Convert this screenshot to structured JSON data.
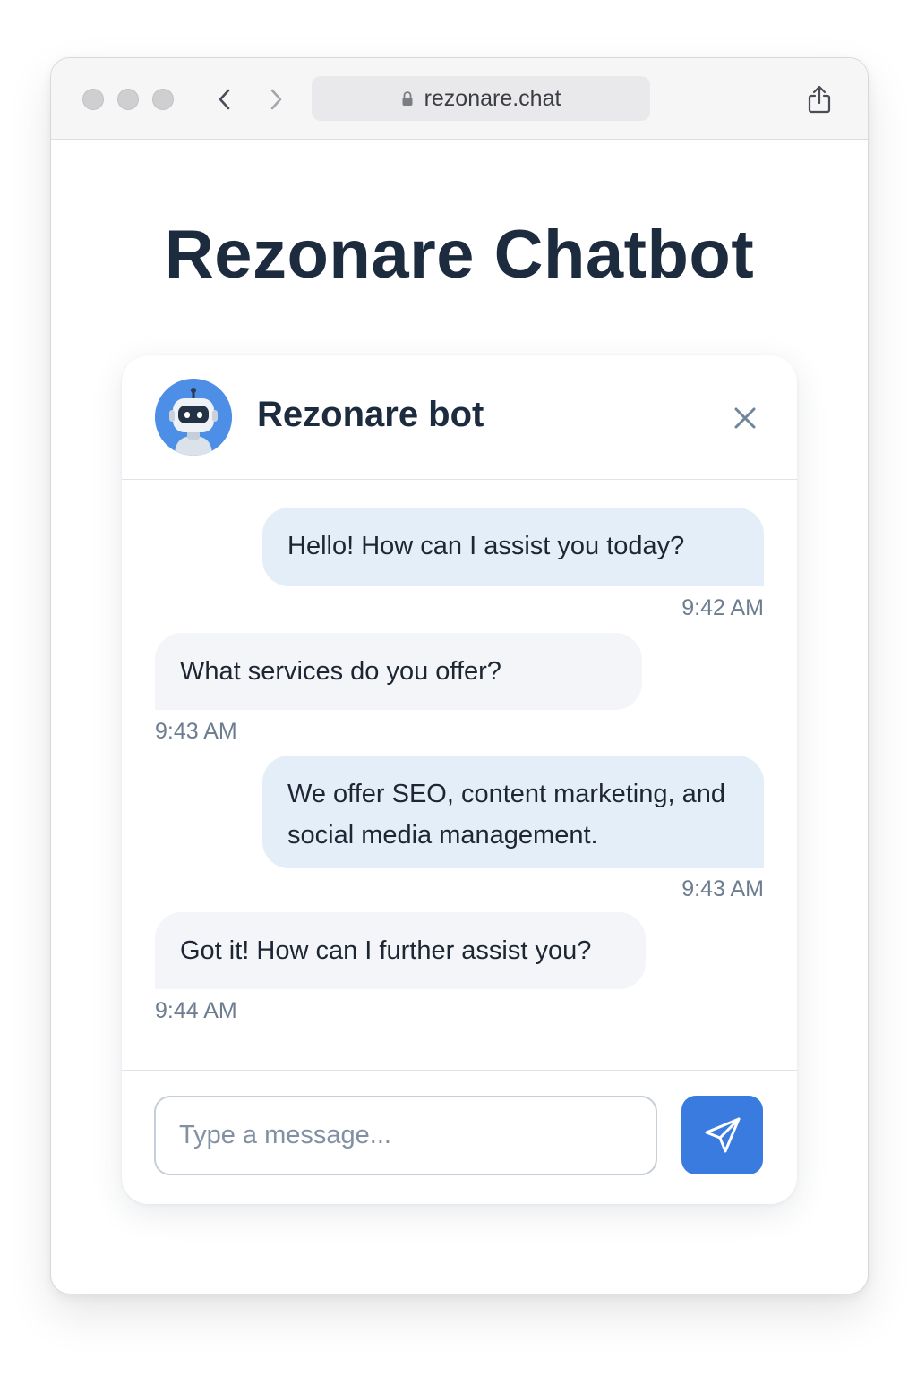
{
  "browser": {
    "url": "rezonare.chat",
    "icons": {
      "back": "chevron-left-icon",
      "forward": "chevron-right-icon",
      "lock": "lock-icon",
      "share": "share-icon"
    }
  },
  "page": {
    "title": "Rezonare Chatbot"
  },
  "chat": {
    "bot_name": "Rezonare bot",
    "avatar_icon": "robot-icon",
    "close_icon": "close-icon",
    "messages": [
      {
        "sender": "bot",
        "text": "Hello! How can I assist you today?",
        "time": "9:42 AM"
      },
      {
        "sender": "user",
        "text": "What services do you offer?",
        "time": "9:43 AM"
      },
      {
        "sender": "bot",
        "text": "We offer SEO, content marketing, and social media management.",
        "time": "9:43 AM"
      },
      {
        "sender": "user",
        "text": "Got it! How can I further assist you?",
        "time": "9:44 AM"
      }
    ],
    "input": {
      "placeholder": "Type a message...",
      "value": ""
    },
    "send_icon": "send-icon"
  },
  "colors": {
    "accent": "#3a7be0",
    "title_text": "#1d2b3f",
    "outgoing_bubble": "#e3eef9",
    "incoming_bubble": "#f3f5f8",
    "timestamp": "#6d7c8e"
  }
}
